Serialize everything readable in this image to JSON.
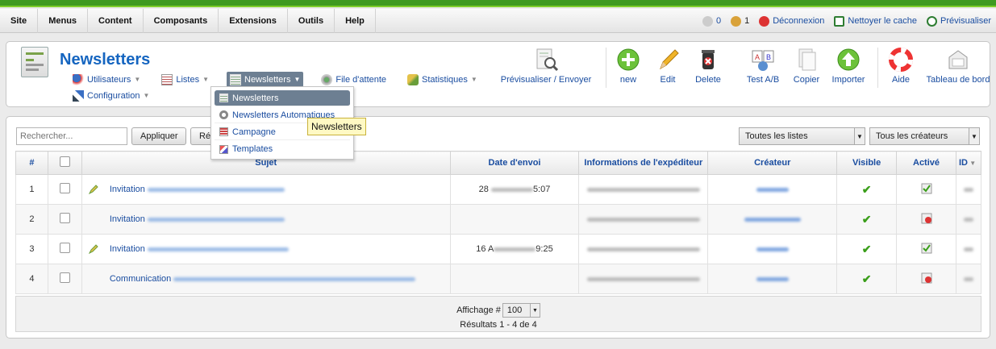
{
  "menubar": {
    "items": [
      "Site",
      "Menus",
      "Content",
      "Composants",
      "Extensions",
      "Outils",
      "Help"
    ],
    "right": {
      "visitors": "0",
      "users": "1",
      "logout": "Déconnexion",
      "clear_cache": "Nettoyer le cache",
      "preview": "Prévisualiser"
    }
  },
  "header": {
    "title": "Newsletters",
    "subnav": [
      {
        "label": "Utilisateurs"
      },
      {
        "label": "Listes"
      },
      {
        "label": "Newsletters"
      },
      {
        "label": "File d'attente"
      },
      {
        "label": "Statistiques"
      }
    ],
    "subnav2": {
      "label": "Configuration"
    }
  },
  "toolbar": {
    "items": [
      "Prévisualiser / Envoyer",
      "new",
      "Edit",
      "Delete",
      "Test A/B",
      "Copier",
      "Importer",
      "Aide",
      "Tableau de bord"
    ]
  },
  "dropdown": {
    "items": [
      "Newsletters",
      "Newsletters Automatiques",
      "Campagne",
      "Templates"
    ]
  },
  "tooltip": "Newsletters",
  "filters": {
    "search_placeholder": "Rechercher...",
    "apply": "Appliquer",
    "reset": "Réi",
    "lists": "Toutes les listes",
    "creators": "Tous les créateurs"
  },
  "table": {
    "columns": [
      "#",
      "",
      "Sujet",
      "Date d'envoi",
      "Informations de l'expéditeur",
      "Créateur",
      "Visible",
      "Activé",
      "ID"
    ],
    "rows": [
      {
        "num": "1",
        "subject": "Invitation",
        "date_a": "28",
        "date_b": "5:07",
        "has_icon": true,
        "activated": true
      },
      {
        "num": "2",
        "subject": "Invitation",
        "date_a": "",
        "date_b": "",
        "has_icon": false,
        "activated": false
      },
      {
        "num": "3",
        "subject": "Invitation",
        "date_a": "16 A",
        "date_b": "9:25",
        "has_icon": true,
        "activated": true
      },
      {
        "num": "4",
        "subject": "Communication",
        "date_a": "",
        "date_b": "",
        "has_icon": false,
        "activated": false
      }
    ]
  },
  "footer": {
    "display_label": "Affichage #",
    "display_value": "100",
    "results": "Résultats 1 - 4 de 4"
  },
  "colors": {
    "accent": "#1565c0",
    "topbar": "#3f9a21",
    "active_nav": "#6d7f92"
  }
}
